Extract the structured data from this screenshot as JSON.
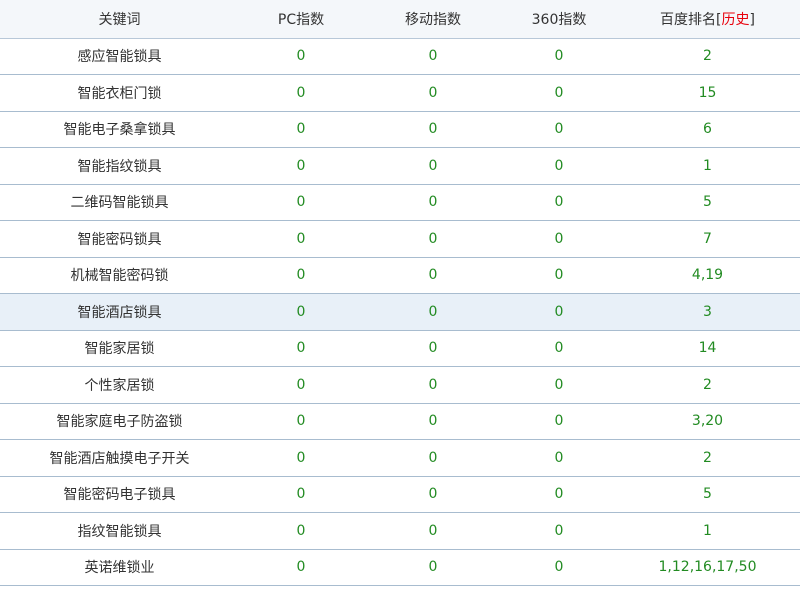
{
  "headers": {
    "keyword": "关键词",
    "pc": "PC指数",
    "mobile": "移动指数",
    "s360": "360指数",
    "rank": "百度排名",
    "rank_open": "[",
    "history": "历史",
    "rank_close": "]"
  },
  "highlight_row_index": 7,
  "rows": [
    {
      "keyword": "感应智能锁具",
      "pc": "0",
      "mobile": "0",
      "s360": "0",
      "rank": "2"
    },
    {
      "keyword": "智能衣柜门锁",
      "pc": "0",
      "mobile": "0",
      "s360": "0",
      "rank": "15"
    },
    {
      "keyword": "智能电子桑拿锁具",
      "pc": "0",
      "mobile": "0",
      "s360": "0",
      "rank": "6"
    },
    {
      "keyword": "智能指纹锁具",
      "pc": "0",
      "mobile": "0",
      "s360": "0",
      "rank": "1"
    },
    {
      "keyword": "二维码智能锁具",
      "pc": "0",
      "mobile": "0",
      "s360": "0",
      "rank": "5"
    },
    {
      "keyword": "智能密码锁具",
      "pc": "0",
      "mobile": "0",
      "s360": "0",
      "rank": "7"
    },
    {
      "keyword": "机械智能密码锁",
      "pc": "0",
      "mobile": "0",
      "s360": "0",
      "rank": "4,19"
    },
    {
      "keyword": "智能酒店锁具",
      "pc": "0",
      "mobile": "0",
      "s360": "0",
      "rank": "3"
    },
    {
      "keyword": "智能家居锁",
      "pc": "0",
      "mobile": "0",
      "s360": "0",
      "rank": "14"
    },
    {
      "keyword": "个性家居锁",
      "pc": "0",
      "mobile": "0",
      "s360": "0",
      "rank": "2"
    },
    {
      "keyword": "智能家庭电子防盗锁",
      "pc": "0",
      "mobile": "0",
      "s360": "0",
      "rank": "3,20"
    },
    {
      "keyword": "智能酒店触摸电子开关",
      "pc": "0",
      "mobile": "0",
      "s360": "0",
      "rank": "2"
    },
    {
      "keyword": "智能密码电子锁具",
      "pc": "0",
      "mobile": "0",
      "s360": "0",
      "rank": "5"
    },
    {
      "keyword": "指纹智能锁具",
      "pc": "0",
      "mobile": "0",
      "s360": "0",
      "rank": "1"
    },
    {
      "keyword": "英诺维锁业",
      "pc": "0",
      "mobile": "0",
      "s360": "0",
      "rank": "1,12,16,17,50"
    }
  ],
  "colors": {
    "number_green": "#228b22",
    "history_red": "#e8000b",
    "highlight_row": "#e8f0f8",
    "border": "#a8bccf"
  }
}
